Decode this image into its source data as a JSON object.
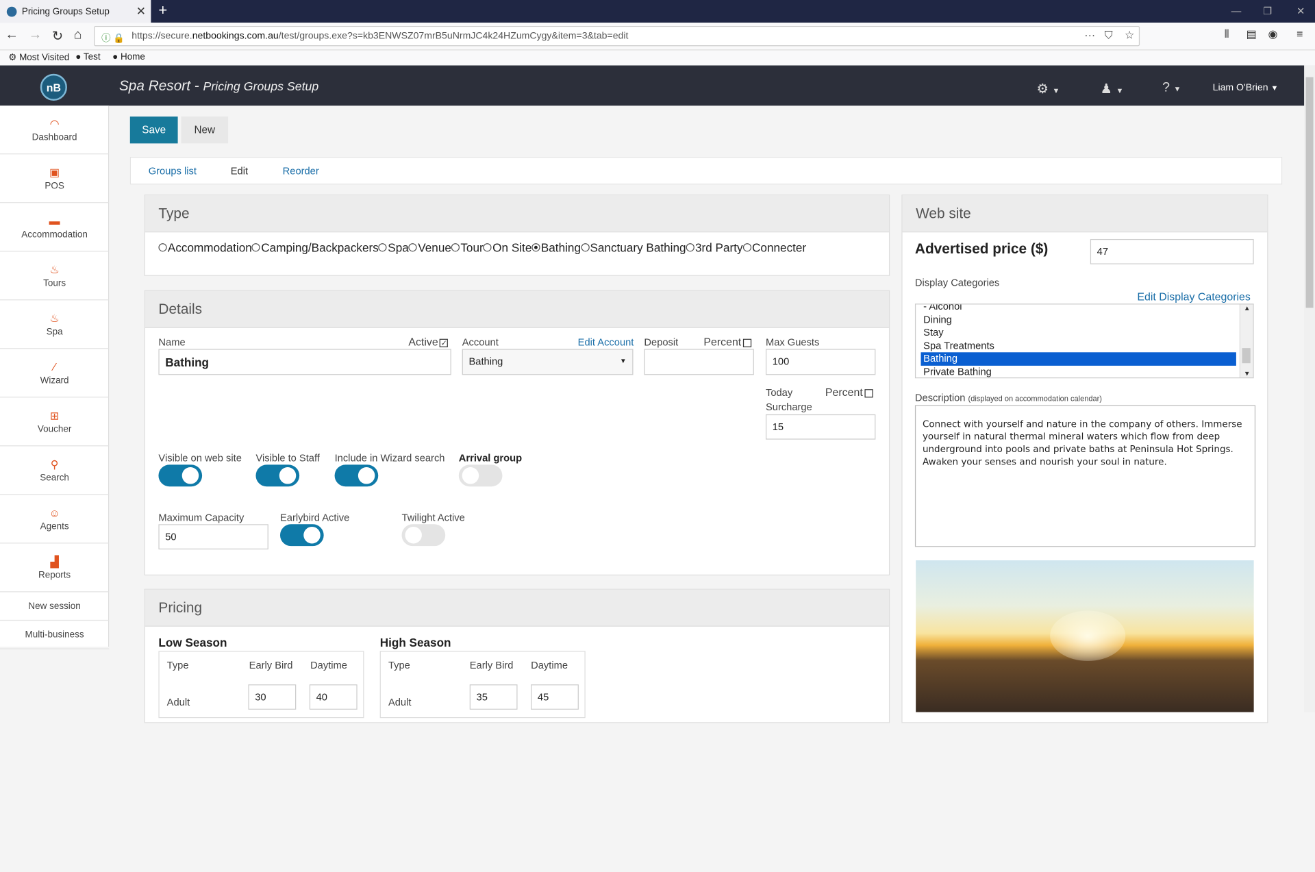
{
  "browser": {
    "tab_title": "Pricing Groups Setup",
    "url_pre": "https://secure.",
    "url_host": "netbookings.com.au",
    "url_path": "/test/groups.exe?s=kb3ENWSZ07mrB5uNrmJC4k24HZumCygy&item=3&tab=edit",
    "bookmarks": [
      "Most Visited",
      "Test",
      "Home"
    ]
  },
  "app": {
    "logo": "nB",
    "title": "Spa Resort",
    "subtitle": "Pricing Groups Setup",
    "user": "Liam O'Brien"
  },
  "sidebar": {
    "items": [
      {
        "label": "Dashboard",
        "icon": "dashboard-icon"
      },
      {
        "label": "POS",
        "icon": "pos-icon"
      },
      {
        "label": "Accommodation",
        "icon": "bed-icon"
      },
      {
        "label": "Tours",
        "icon": "tours-icon"
      },
      {
        "label": "Spa",
        "icon": "spa-icon"
      },
      {
        "label": "Wizard",
        "icon": "wand-icon"
      },
      {
        "label": "Voucher",
        "icon": "gift-icon"
      },
      {
        "label": "Search",
        "icon": "search-icon"
      },
      {
        "label": "Agents",
        "icon": "agent-icon"
      },
      {
        "label": "Reports",
        "icon": "chart-icon"
      }
    ],
    "links": [
      "New session",
      "Multi-business"
    ]
  },
  "toolbar": {
    "save": "Save",
    "new": "New"
  },
  "tabs": [
    "Groups list",
    "Edit",
    "Reorder"
  ],
  "type": {
    "heading": "Type",
    "options": [
      "Accommodation",
      "Camping/Backpackers",
      "Spa",
      "Venue",
      "Tour",
      "On Site",
      "Bathing",
      "Sanctuary Bathing",
      "3rd Party",
      "Connecter"
    ],
    "selected": "Bathing"
  },
  "details": {
    "heading": "Details",
    "name_label": "Name",
    "name": "Bathing",
    "active_label": "Active",
    "account_label": "Account",
    "edit_account": "Edit Account",
    "account": "Bathing",
    "deposit_label": "Deposit",
    "percent_label": "Percent",
    "deposit": "",
    "maxguests_label": "Max Guests",
    "maxguests": "100",
    "today_label": "Today",
    "surcharge_label": "Surcharge",
    "surcharge": "15",
    "visible_web": "Visible on web site",
    "visible_staff": "Visible to Staff",
    "wizard": "Include in Wizard search",
    "arrival": "Arrival group",
    "maxcap_label": "Maximum Capacity",
    "maxcap": "50",
    "earlybird": "Earlybird Active",
    "twilight": "Twilight Active"
  },
  "pricing": {
    "heading": "Pricing",
    "low": {
      "title": "Low Season",
      "cols": [
        "Type",
        "Early Bird",
        "Daytime"
      ],
      "row": "Adult",
      "earlybird": "30",
      "daytime": "40"
    },
    "high": {
      "title": "High Season",
      "cols": [
        "Type",
        "Early Bird",
        "Daytime"
      ],
      "row": "Adult",
      "earlybird": "35",
      "daytime": "45"
    }
  },
  "website": {
    "heading": "Web site",
    "adv_label": "Advertised price ($)",
    "adv_price": "47",
    "cat_label": "Display Categories",
    "edit_cats": "Edit Display Categories",
    "categories": [
      "- Alcohol",
      "Dining",
      "Stay",
      "Spa Treatments",
      "Bathing",
      "Private Bathing"
    ],
    "selected_category": "Bathing",
    "desc_label": "Description",
    "desc_note": "(displayed on accommodation calendar)",
    "description": "Connect with yourself and nature in the company of others. Immerse yourself in natural thermal mineral waters which flow from deep underground into pools and private baths at Peninsula Hot Springs. Awaken your senses and nourish your soul in nature."
  },
  "colors": {
    "accent": "#177a9b",
    "toggle_on": "#0f7aa8",
    "header": "#2c2f3a",
    "selection": "#0a5fd1"
  }
}
